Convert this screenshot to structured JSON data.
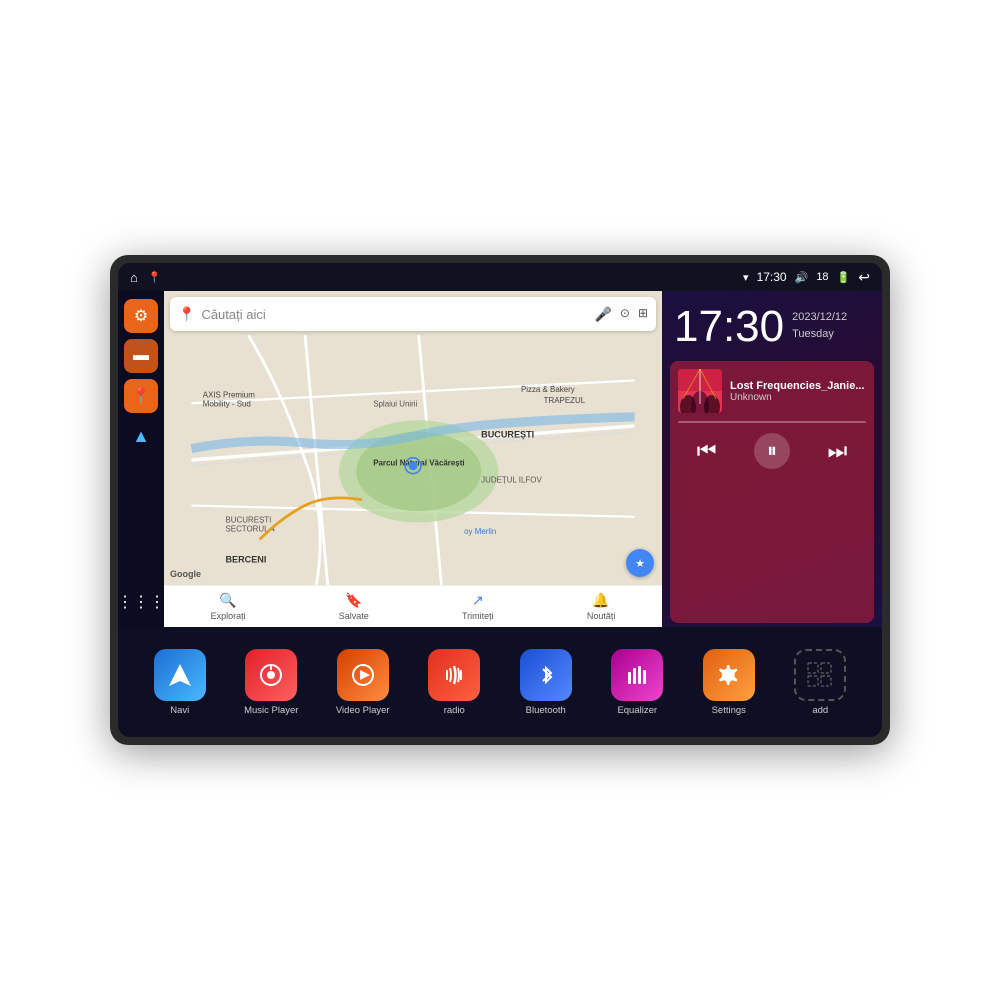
{
  "device": {
    "status_bar": {
      "left_icons": [
        "home",
        "location"
      ],
      "wifi": "▾",
      "time": "17:30",
      "volume": "🔊",
      "battery_level": "18",
      "battery_icon": "🔋",
      "back": "↩"
    },
    "clock": {
      "time": "17:30",
      "date_year": "2023/12/12",
      "date_day": "Tuesday"
    },
    "music": {
      "title": "Lost Frequencies_Janie...",
      "artist": "Unknown"
    },
    "map": {
      "search_placeholder": "Căutați aici",
      "labels": [
        "AXIS Premium Mobility - Sud",
        "Pizza & Bakery",
        "TRAPEZUL",
        "Parcul Natural Văcărești",
        "BUCUREȘTI",
        "SECTORUL 4",
        "JUDEȚUL ILFOV",
        "BERCENI"
      ],
      "bottom_nav": [
        "Explorați",
        "Salvate",
        "Trimiteți",
        "Noutăți"
      ]
    },
    "sidebar": {
      "icons": [
        "settings",
        "folder",
        "location",
        "navigation",
        "grid"
      ]
    },
    "apps": [
      {
        "label": "Navi",
        "icon": "navi",
        "symbol": "▲"
      },
      {
        "label": "Music Player",
        "icon": "music",
        "symbol": "♪"
      },
      {
        "label": "Video Player",
        "icon": "video",
        "symbol": "▶"
      },
      {
        "label": "radio",
        "icon": "radio",
        "symbol": "📻"
      },
      {
        "label": "Bluetooth",
        "icon": "bluetooth",
        "symbol": "⚡"
      },
      {
        "label": "Equalizer",
        "icon": "equalizer",
        "symbol": "📊"
      },
      {
        "label": "Settings",
        "icon": "settings",
        "symbol": "⚙"
      },
      {
        "label": "add",
        "icon": "add",
        "symbol": "+"
      }
    ]
  }
}
